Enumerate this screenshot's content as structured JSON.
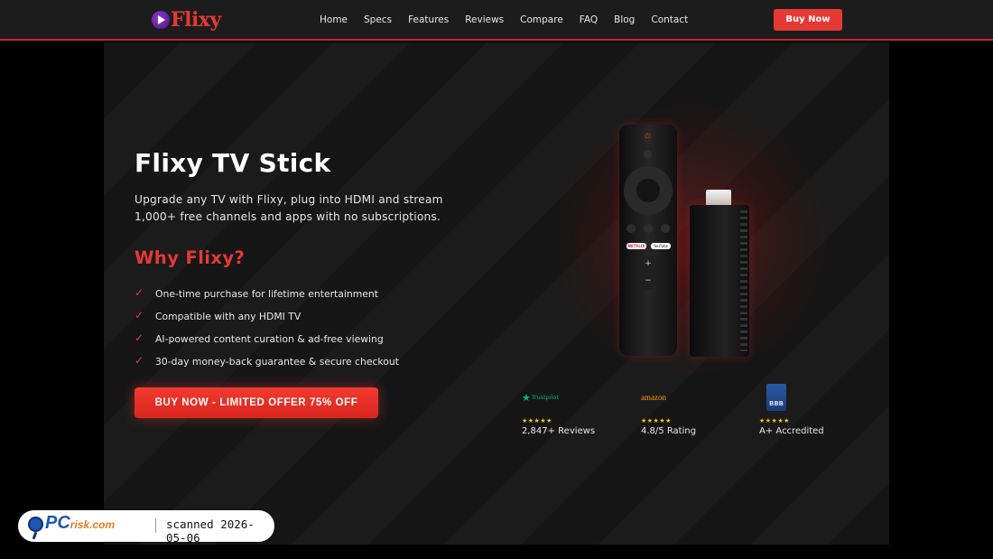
{
  "brand": {
    "logo_text": "Flixy"
  },
  "nav": {
    "links": [
      "Home",
      "Specs",
      "Features",
      "Reviews",
      "Compare",
      "FAQ",
      "Blog",
      "Contact"
    ],
    "buy_label": "Buy Now"
  },
  "hero": {
    "title": "Flixy TV Stick",
    "subtitle": "Upgrade any TV with Flixy, plug into HDMI and stream 1,000+ free channels and apps with no subscriptions.",
    "why_heading": "Why Flixy?",
    "features": [
      "One-time purchase for lifetime entertainment",
      "Compatible with any HDMI TV",
      "AI-powered content curation & ad-free viewing",
      "30-day money-back guarantee & secure checkout"
    ],
    "cta_label": "BUY NOW - LIMITED OFFER 75% OFF"
  },
  "product": {
    "remote_buttons": {
      "netflix": "NETFLIX",
      "youtube": "YouTube",
      "vol_up": "+",
      "vol_down": "−",
      "power": "⏻"
    }
  },
  "badges": [
    {
      "logo": "trustpilot",
      "logo_text": "Trustpilot",
      "stars": "★★★★★",
      "text": "2,847+ Reviews"
    },
    {
      "logo": "amazon",
      "logo_text": "amazon",
      "stars": "★★★★★",
      "text": "4.8/5 Rating"
    },
    {
      "logo": "bbb",
      "logo_text": "BBB",
      "stars": "★★★★★",
      "text": "A+ Accredited"
    }
  ],
  "watermark": {
    "brand_main": "PC",
    "brand_small": "risk.com",
    "text": "scanned 2026-05-06"
  },
  "colors": {
    "accent": "#e53935",
    "nav_bg": "#1c1c1c",
    "hero_bg": "#161616",
    "trustpilot": "#00b67a",
    "amazon": "#ff9900",
    "bbb": "#2b5aa6"
  }
}
